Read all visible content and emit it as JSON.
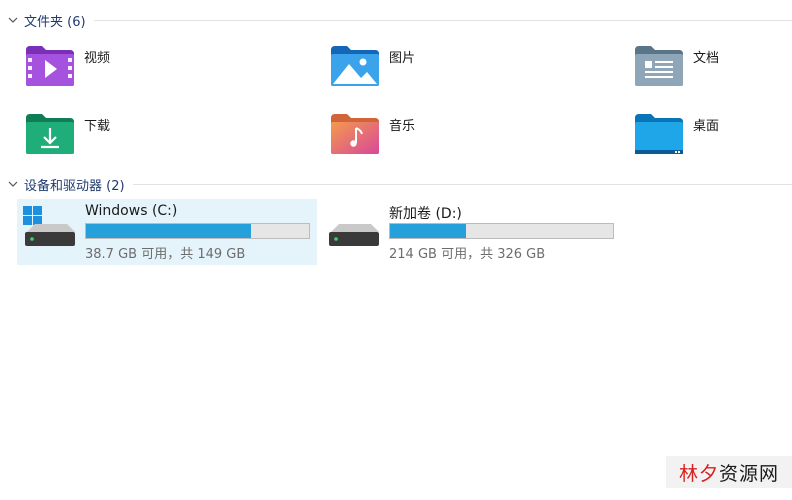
{
  "folders_section": {
    "title": "文件夹 (6)",
    "items": [
      {
        "label": "视频",
        "icon": "video-folder-icon"
      },
      {
        "label": "图片",
        "icon": "pictures-folder-icon"
      },
      {
        "label": "文档",
        "icon": "documents-folder-icon"
      },
      {
        "label": "下载",
        "icon": "downloads-folder-icon"
      },
      {
        "label": "音乐",
        "icon": "music-folder-icon"
      },
      {
        "label": "桌面",
        "icon": "desktop-folder-icon"
      }
    ]
  },
  "drives_section": {
    "title": "设备和驱动器 (2)",
    "drives": [
      {
        "name": "Windows (C:)",
        "free_text": "38.7 GB 可用，共 149 GB",
        "used_fraction": 0.74,
        "selected": true
      },
      {
        "name": "新加卷 (D:)",
        "free_text": "214 GB 可用，共 326 GB",
        "used_fraction": 0.34,
        "selected": false
      }
    ]
  },
  "watermark": {
    "part1": "林夕",
    "part2": "资源网"
  },
  "colors": {
    "accent": "#26a0da",
    "selection": "#e5f3fb",
    "header_text": "#1f3b6e",
    "watermark_red": "#d81e1e"
  }
}
